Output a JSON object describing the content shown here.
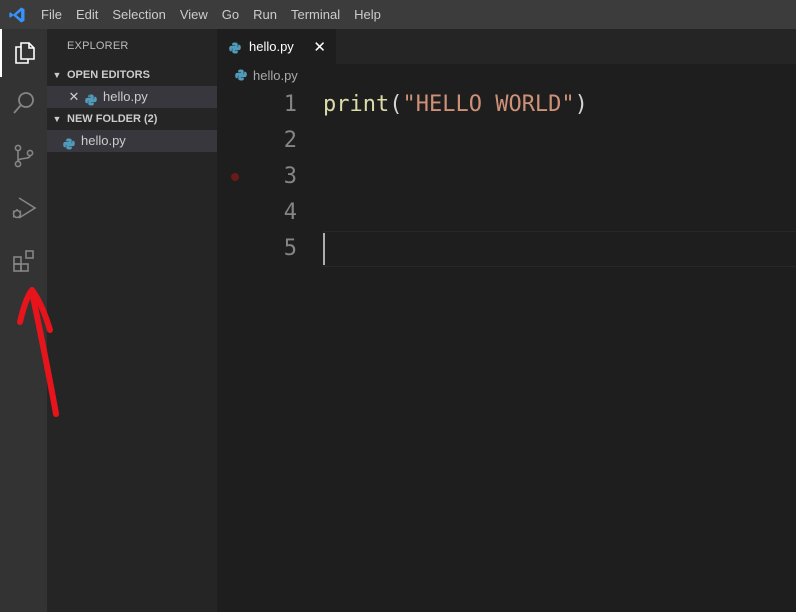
{
  "menu": {
    "items": [
      "File",
      "Edit",
      "Selection",
      "View",
      "Go",
      "Run",
      "Terminal",
      "Help"
    ]
  },
  "activity_bar": {
    "items": [
      {
        "name": "explorer",
        "icon": "files-icon",
        "active": true
      },
      {
        "name": "search",
        "icon": "search-icon",
        "active": false
      },
      {
        "name": "source-control",
        "icon": "source-control-icon",
        "active": false
      },
      {
        "name": "run-debug",
        "icon": "run-debug-icon",
        "active": false
      },
      {
        "name": "extensions",
        "icon": "extensions-icon",
        "active": false
      }
    ]
  },
  "sidebar": {
    "title": "EXPLORER",
    "open_editors": {
      "header": "OPEN EDITORS",
      "files": [
        {
          "name": "hello.py"
        }
      ]
    },
    "folder": {
      "header": "NEW FOLDER (2)",
      "files": [
        {
          "name": "hello.py"
        }
      ]
    }
  },
  "editor": {
    "tab": {
      "label": "hello.py",
      "close": "✕"
    },
    "breadcrumb": "hello.py",
    "lines": [
      {
        "number": "1",
        "fn": "print",
        "open": "(",
        "str": "\"HELLO WORLD\"",
        "close": ")"
      },
      {
        "number": "2"
      },
      {
        "number": "3"
      },
      {
        "number": "4"
      },
      {
        "number": "5"
      }
    ],
    "cursor_line": 5,
    "breakpoint_line": 3
  },
  "colors": {
    "accent": "#3794ff",
    "python_icon": "#519aba",
    "annotation_arrow": "#e8141b"
  }
}
